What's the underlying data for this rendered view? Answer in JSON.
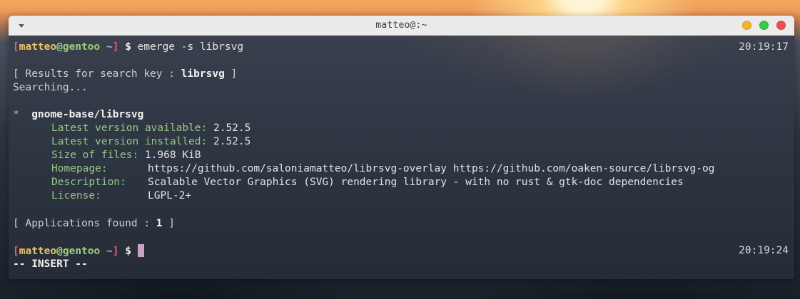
{
  "window": {
    "title": "matteo@:~"
  },
  "prompt": {
    "open_bracket": "[",
    "user": "matteo",
    "at": "@",
    "host": "gentoo",
    "path": "~",
    "close_bracket": "]",
    "symbol": "$"
  },
  "commands": [
    {
      "text": "emerge -s librsvg",
      "time": "20:19:17"
    },
    {
      "text": "",
      "time": "20:19:24"
    }
  ],
  "output": {
    "results_prefix": "[ Results for search key : ",
    "search_key": "librsvg",
    "results_suffix": " ]",
    "searching": "Searching...",
    "package_star": "*",
    "package_name": "gnome-base/librsvg",
    "fields": [
      {
        "label": "Latest version available:",
        "value": "2.52.5"
      },
      {
        "label": "Latest version installed:",
        "value": "2.52.5"
      },
      {
        "label": "Size of files:",
        "value": "1.968 KiB"
      },
      {
        "label": "Homepage:",
        "value": "https://github.com/saloniamatteo/librsvg-overlay https://github.com/oaken-source/librsvg-og"
      },
      {
        "label": "Description:",
        "value": "Scalable Vector Graphics (SVG) rendering library - with no rust & gtk-doc dependencies"
      },
      {
        "label": "License:",
        "value": "LGPL-2+"
      }
    ],
    "apps_prefix": "[ Applications found : ",
    "apps_count": "1",
    "apps_suffix": " ]"
  },
  "status_line": "-- INSERT --",
  "colors": {
    "prompt_bracket": "#e0606a",
    "prompt_user": "#e8c56a",
    "prompt_host": "#9cd07a",
    "prompt_path": "#7ec8c8",
    "field_label": "#98c785",
    "cursor": "#c9a3c4",
    "btn_minimize": "#f2b62d",
    "btn_maximize": "#39c748",
    "btn_close": "#ef4e4e"
  },
  "icons": {
    "menu": "chevron-down-icon",
    "minimize": "minimize-dot-icon",
    "maximize": "maximize-dot-icon",
    "close": "close-dot-icon"
  }
}
